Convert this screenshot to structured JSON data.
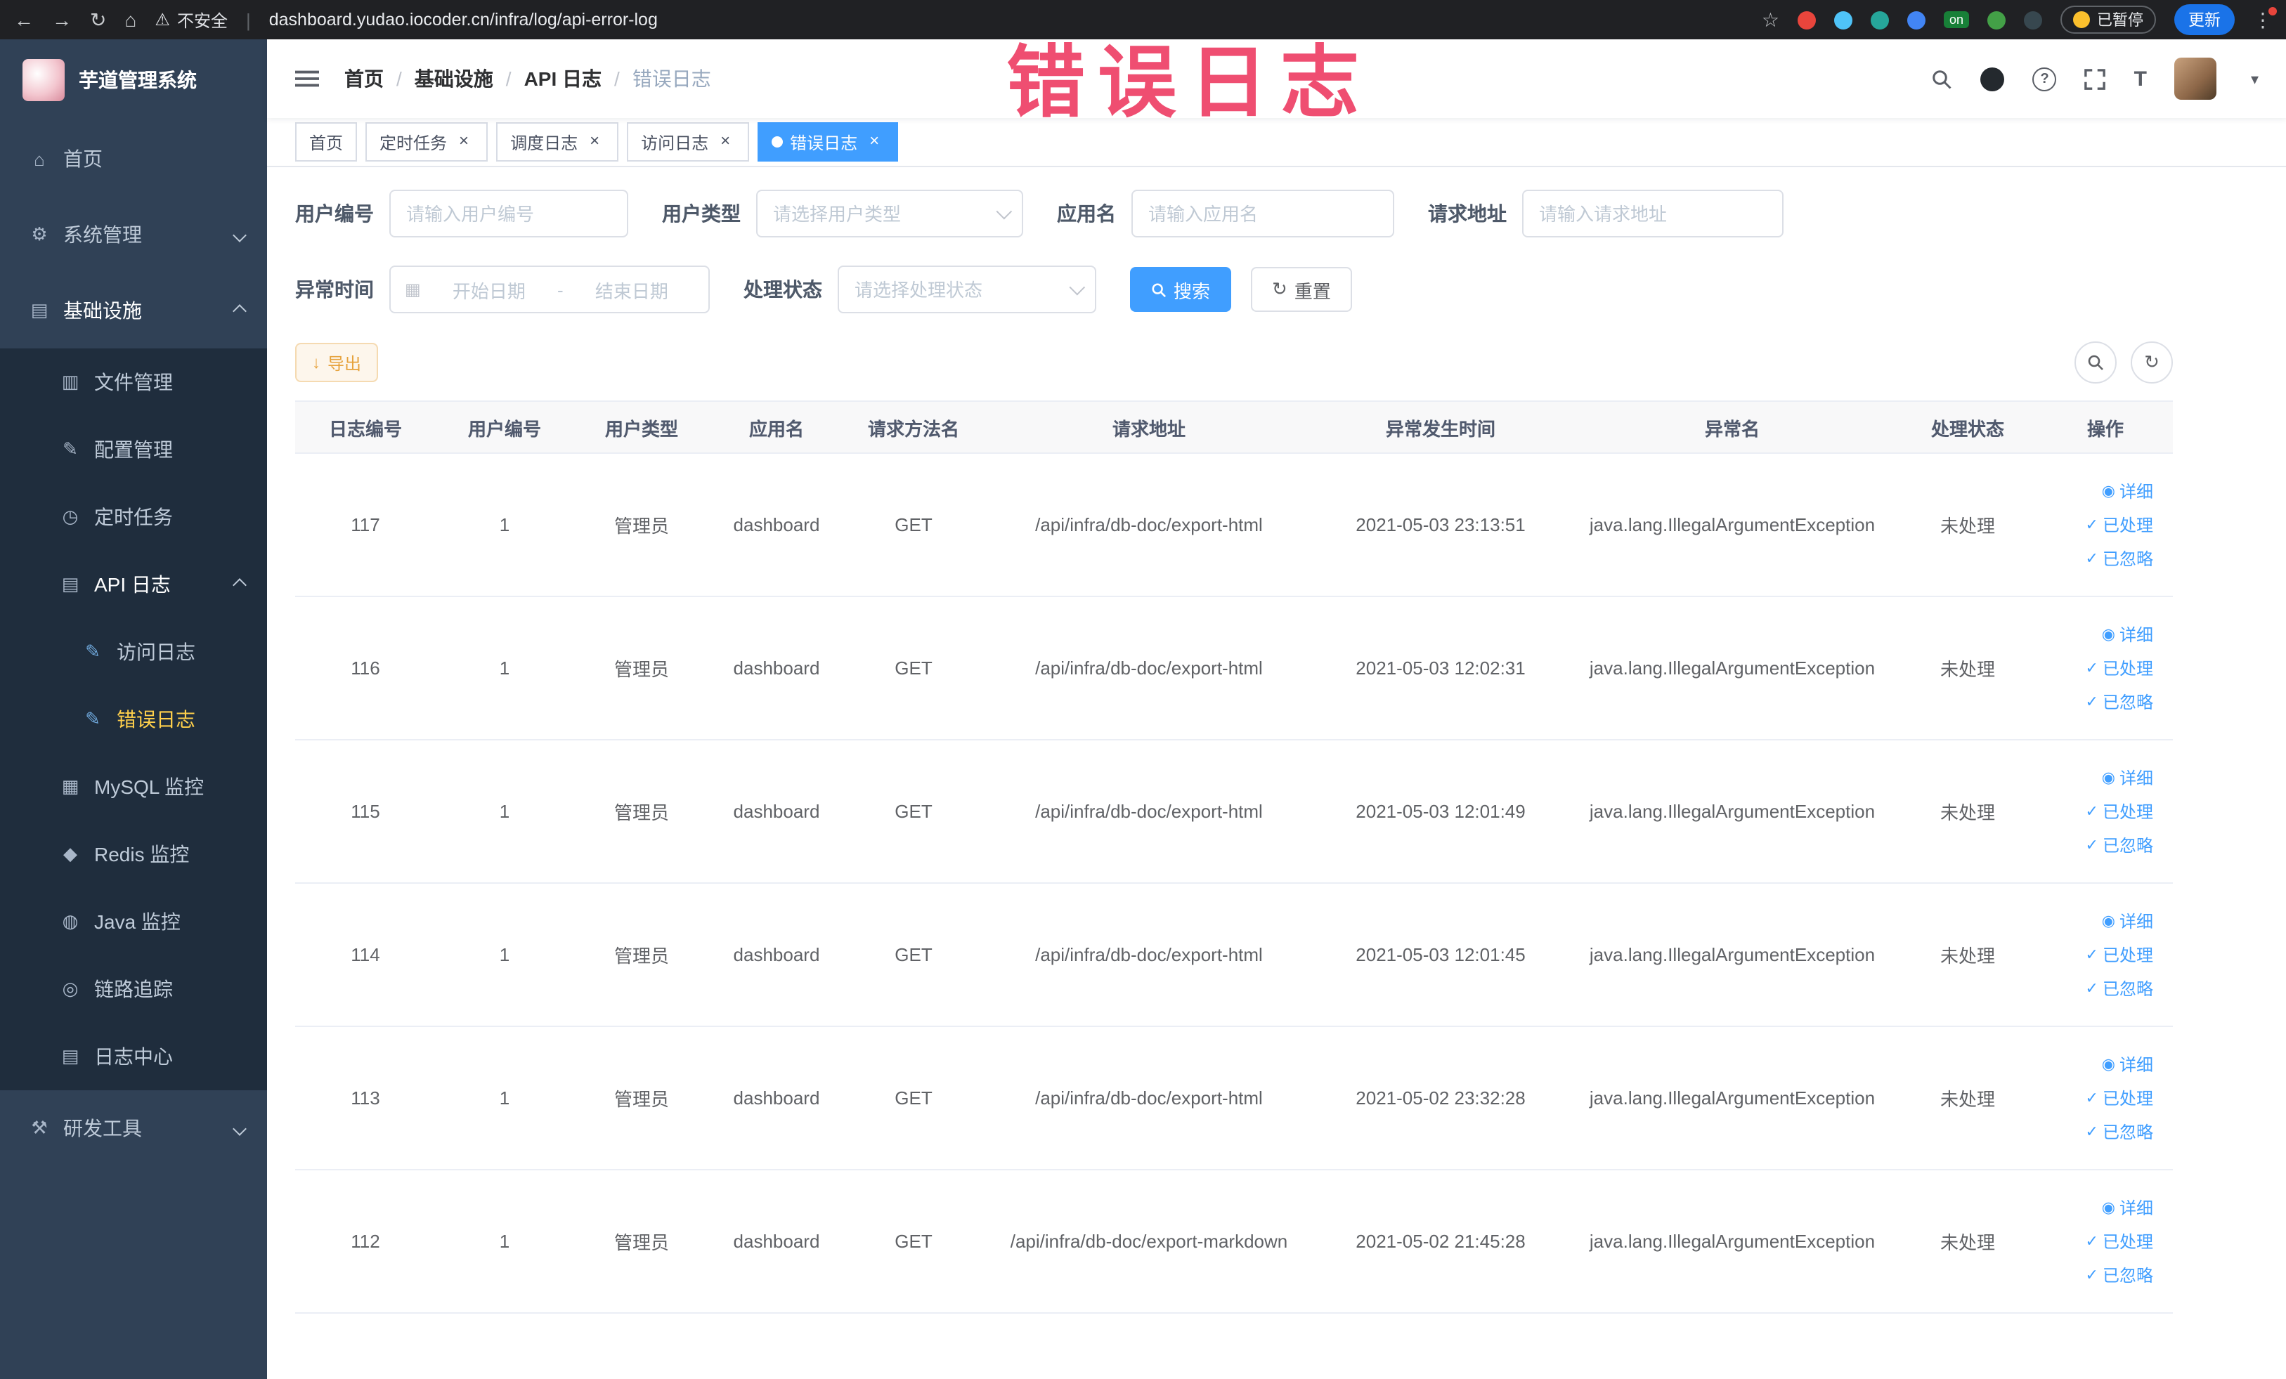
{
  "theme": {
    "accent": "#409eff",
    "warning": "#e6a23c",
    "sidebar_bg": "#304156",
    "submenu_bg": "#1f2d3d",
    "active_menu_text": "#ffd04b",
    "annotation_color": "#ee4066"
  },
  "icons": {
    "back": "←",
    "forward": "→",
    "reload": "↻",
    "home": "⌂",
    "warning": "⚠",
    "star": "☆",
    "more": "⋮",
    "caret_down": "▾",
    "check": "✓",
    "eye": "◉",
    "download": "↓",
    "refresh": "↻",
    "calendar": "▦",
    "close": "×",
    "question": "?",
    "menu_home": "⌂",
    "menu_system": "⚙",
    "menu_infra": "▤",
    "menu_file": "▥",
    "menu_config": "✎",
    "menu_job": "◷",
    "menu_api": "▤",
    "menu_doc": "✎",
    "menu_mysql": "▦",
    "menu_redis": "◆",
    "menu_java": "◍",
    "menu_trace": "◎",
    "menu_log": "▤",
    "menu_tools": "⚒"
  },
  "browser": {
    "security_label": "不安全",
    "url": "dashboard.yudao.iocoder.cn/infra/log/api-error-log",
    "extension_on_badge": "on",
    "paused_badge": "已暂停",
    "update_button": "更新"
  },
  "annotation": "错误日志",
  "sidebar": {
    "logo_title": "芋道管理系统",
    "menu": {
      "home": "首页",
      "system": "系统管理",
      "infra": "基础设施",
      "file": "文件管理",
      "config": "配置管理",
      "job": "定时任务",
      "api_log": "API 日志",
      "access_log": "访问日志",
      "error_log": "错误日志",
      "mysql": "MySQL 监控",
      "redis": "Redis 监控",
      "java": "Java 监控",
      "trace": "链路追踪",
      "log_center": "日志中心",
      "dev_tools": "研发工具"
    }
  },
  "header": {
    "breadcrumb": [
      "首页",
      "基础设施",
      "API 日志",
      "错误日志"
    ]
  },
  "tabs": [
    {
      "label": "首页"
    },
    {
      "label": "定时任务"
    },
    {
      "label": "调度日志"
    },
    {
      "label": "访问日志"
    },
    {
      "label": "错误日志"
    }
  ],
  "filters": {
    "user_id_label": "用户编号",
    "user_id_placeholder": "请输入用户编号",
    "user_type_label": "用户类型",
    "user_type_placeholder": "请选择用户类型",
    "app_name_label": "应用名",
    "app_name_placeholder": "请输入应用名",
    "request_url_label": "请求地址",
    "request_url_placeholder": "请输入请求地址",
    "exception_time_label": "异常时间",
    "date_start_placeholder": "开始日期",
    "date_separator": "-",
    "date_end_placeholder": "结束日期",
    "process_status_label": "处理状态",
    "process_status_placeholder": "请选择处理状态",
    "search_button": "搜索",
    "reset_button": "重置"
  },
  "toolbar": {
    "export_button": "导出"
  },
  "table": {
    "columns": [
      "日志编号",
      "用户编号",
      "用户类型",
      "应用名",
      "请求方法名",
      "请求地址",
      "异常发生时间",
      "异常名",
      "处理状态",
      "操作"
    ],
    "actions": [
      "详细",
      "已处理",
      "已忽略"
    ],
    "rows": [
      {
        "id": "117",
        "user_id": "1",
        "user_type": "管理员",
        "app": "dashboard",
        "method": "GET",
        "url": "/api/infra/db-doc/export-html",
        "time": "2021-05-03 23:13:51",
        "exception": "java.lang.IllegalArgumentException",
        "status": "未处理"
      },
      {
        "id": "116",
        "user_id": "1",
        "user_type": "管理员",
        "app": "dashboard",
        "method": "GET",
        "url": "/api/infra/db-doc/export-html",
        "time": "2021-05-03 12:02:31",
        "exception": "java.lang.IllegalArgumentException",
        "status": "未处理"
      },
      {
        "id": "115",
        "user_id": "1",
        "user_type": "管理员",
        "app": "dashboard",
        "method": "GET",
        "url": "/api/infra/db-doc/export-html",
        "time": "2021-05-03 12:01:49",
        "exception": "java.lang.IllegalArgumentException",
        "status": "未处理"
      },
      {
        "id": "114",
        "user_id": "1",
        "user_type": "管理员",
        "app": "dashboard",
        "method": "GET",
        "url": "/api/infra/db-doc/export-html",
        "time": "2021-05-03 12:01:45",
        "exception": "java.lang.IllegalArgumentException",
        "status": "未处理"
      },
      {
        "id": "113",
        "user_id": "1",
        "user_type": "管理员",
        "app": "dashboard",
        "method": "GET",
        "url": "/api/infra/db-doc/export-html",
        "time": "2021-05-02 23:32:28",
        "exception": "java.lang.IllegalArgumentException",
        "status": "未处理"
      },
      {
        "id": "112",
        "user_id": "1",
        "user_type": "管理员",
        "app": "dashboard",
        "method": "GET",
        "url": "/api/infra/db-doc/export-markdown",
        "time": "2021-05-02 21:45:28",
        "exception": "java.lang.IllegalArgumentException",
        "status": "未处理"
      }
    ]
  }
}
